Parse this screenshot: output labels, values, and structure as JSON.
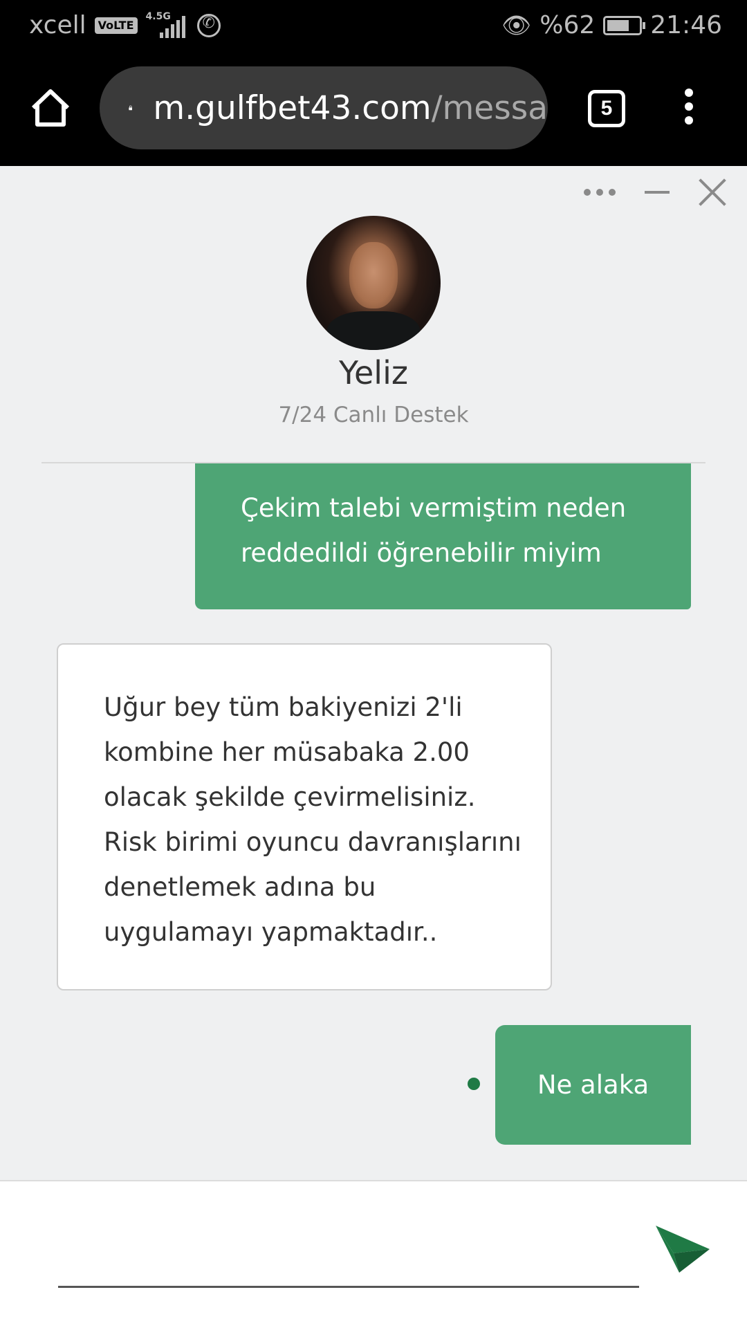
{
  "status_bar": {
    "carrier": "xcell",
    "volte": "VoLTE",
    "network": "4.5G",
    "battery": "%62",
    "time": "21:46"
  },
  "browser": {
    "url_host": "m.gulfbet43.com",
    "url_path": "/messa",
    "tab_count": "5"
  },
  "chat": {
    "agent_name": "Yeliz",
    "agent_role": "7/24 Canlı Destek",
    "messages": [
      {
        "from": "user",
        "text": "Çekim talebi vermiştim neden reddedildi öğrenebilir miyim"
      },
      {
        "from": "agent",
        "text": "Uğur bey tüm bakiyenizi 2'li kombine her müsabaka 2.00 olacak şekilde çevirmelisiniz. Risk birimi oyuncu davranışlarını denetlemek adına bu uygulamayı yapmaktadır.."
      },
      {
        "from": "user",
        "text": "Ne alaka"
      }
    ],
    "composer": {
      "value": "",
      "placeholder": ""
    }
  },
  "colors": {
    "accent_green": "#4ea575",
    "send_green": "#1f7a45"
  },
  "icons": [
    "home-icon",
    "lock-icon",
    "tabs-icon",
    "menu-icon",
    "more-icon",
    "minimize-icon",
    "close-icon",
    "send-icon",
    "eye-icon",
    "battery-icon",
    "whatsapp-icon"
  ]
}
